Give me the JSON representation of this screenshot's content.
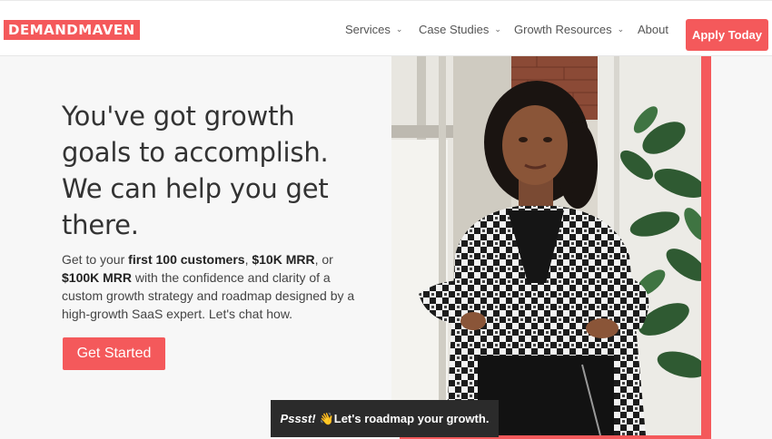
{
  "brand": {
    "logo_text": "DEMANDMAVEN"
  },
  "nav": {
    "items": [
      {
        "label": "Services",
        "has_dropdown": true
      },
      {
        "label": "Case Studies",
        "has_dropdown": true
      },
      {
        "label": "Growth Resources",
        "has_dropdown": true
      },
      {
        "label": "About",
        "has_dropdown": false
      }
    ],
    "cta_label": "Apply Today",
    "dropdown_icon": "chevron-down-icon"
  },
  "hero": {
    "headline_lines": [
      "You've got growth",
      "goals to accomplish.",
      "We can help you get",
      "there."
    ],
    "subtext": {
      "p1": "Get to your ",
      "b1": "first 100 customers",
      "p2": ", ",
      "b2": "$10K MRR",
      "p3": ", or ",
      "b3": "$100K MRR",
      "p4": " with the confidence and clarity of a custom growth strategy and roadmap designed by a high-growth SaaS expert. Let's chat how."
    },
    "cta_label": "Get Started",
    "image_icon": "woman-portrait-photo"
  },
  "toast": {
    "lead": "Pssst!",
    "emoji": "👋",
    "message": "Let's roadmap your growth."
  },
  "colors": {
    "accent": "#f4595b",
    "toast_bg": "#2b2b2b",
    "page_bg": "#f7f7f7"
  }
}
